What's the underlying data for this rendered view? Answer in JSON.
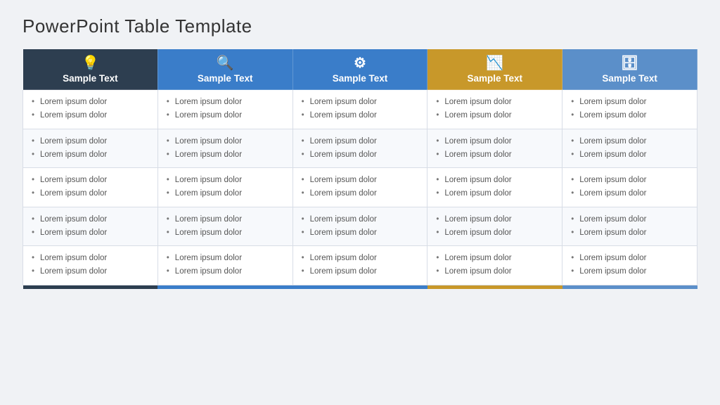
{
  "page": {
    "title": "PowerPoint Table Template"
  },
  "columns": [
    {
      "id": "col-1",
      "icon": "💡",
      "icon_name": "bulb-icon",
      "label": "Sample Text",
      "color": "#2d3e50"
    },
    {
      "id": "col-2",
      "icon": "🔍",
      "icon_name": "search-icon",
      "label": "Sample Text",
      "color": "#3a7dc9"
    },
    {
      "id": "col-3",
      "icon": "⚙",
      "icon_name": "gear-icon",
      "label": "Sample Text",
      "color": "#3a7dc9"
    },
    {
      "id": "col-4",
      "icon": "📉",
      "icon_name": "chart-icon",
      "label": "Sample Text",
      "color": "#c8982a"
    },
    {
      "id": "col-5",
      "icon": "🗄",
      "icon_name": "database-icon",
      "label": "Sample Text",
      "color": "#5b8fc9"
    }
  ],
  "rows": [
    {
      "cells": [
        [
          "Lorem ipsum dolor",
          "Lorem ipsum dolor"
        ],
        [
          "Lorem ipsum dolor",
          "Lorem ipsum dolor"
        ],
        [
          "Lorem ipsum dolor",
          "Lorem ipsum dolor"
        ],
        [
          "Lorem ipsum dolor",
          "Lorem ipsum dolor"
        ],
        [
          "Lorem ipsum dolor",
          "Lorem ipsum dolor"
        ]
      ]
    },
    {
      "cells": [
        [
          "Lorem ipsum dolor",
          "Lorem ipsum dolor"
        ],
        [
          "Lorem ipsum dolor",
          "Lorem ipsum dolor"
        ],
        [
          "Lorem ipsum dolor",
          "Lorem ipsum dolor"
        ],
        [
          "Lorem ipsum dolor",
          "Lorem ipsum dolor"
        ],
        [
          "Lorem ipsum dolor",
          "Lorem ipsum dolor"
        ]
      ]
    },
    {
      "cells": [
        [
          "Lorem ipsum dolor",
          "Lorem ipsum dolor"
        ],
        [
          "Lorem ipsum dolor",
          "Lorem ipsum dolor"
        ],
        [
          "Lorem ipsum dolor",
          "Lorem ipsum dolor"
        ],
        [
          "Lorem ipsum dolor",
          "Lorem ipsum dolor"
        ],
        [
          "Lorem ipsum dolor",
          "Lorem ipsum dolor"
        ]
      ]
    },
    {
      "cells": [
        [
          "Lorem ipsum dolor",
          "Lorem ipsum dolor"
        ],
        [
          "Lorem ipsum dolor",
          "Lorem ipsum dolor"
        ],
        [
          "Lorem ipsum dolor",
          "Lorem ipsum dolor"
        ],
        [
          "Lorem ipsum dolor",
          "Lorem ipsum dolor"
        ],
        [
          "Lorem ipsum dolor",
          "Lorem ipsum dolor"
        ]
      ]
    },
    {
      "cells": [
        [
          "Lorem ipsum dolor",
          "Lorem ipsum dolor"
        ],
        [
          "Lorem ipsum dolor",
          "Lorem ipsum dolor"
        ],
        [
          "Lorem ipsum dolor",
          "Lorem ipsum dolor"
        ],
        [
          "Lorem ipsum dolor",
          "Lorem ipsum dolor"
        ],
        [
          "Lorem ipsum dolor",
          "Lorem ipsum dolor"
        ]
      ]
    }
  ]
}
